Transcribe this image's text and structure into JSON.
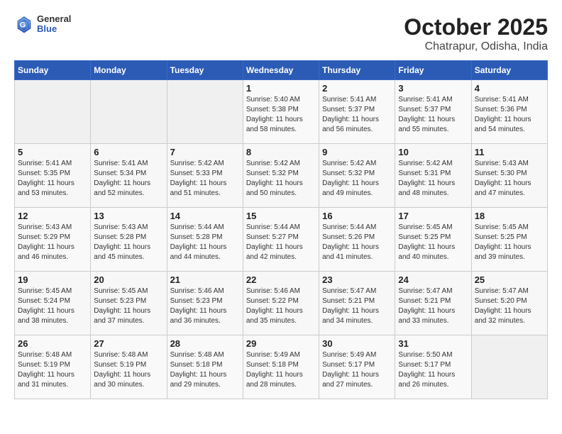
{
  "header": {
    "logo": {
      "general": "General",
      "blue": "Blue"
    },
    "title": "October 2025",
    "location": "Chatrapur, Odisha, India"
  },
  "calendar": {
    "weekdays": [
      "Sunday",
      "Monday",
      "Tuesday",
      "Wednesday",
      "Thursday",
      "Friday",
      "Saturday"
    ],
    "weeks": [
      [
        {
          "day": "",
          "info": ""
        },
        {
          "day": "",
          "info": ""
        },
        {
          "day": "",
          "info": ""
        },
        {
          "day": "1",
          "info": "Sunrise: 5:40 AM\nSunset: 5:38 PM\nDaylight: 11 hours\nand 58 minutes."
        },
        {
          "day": "2",
          "info": "Sunrise: 5:41 AM\nSunset: 5:37 PM\nDaylight: 11 hours\nand 56 minutes."
        },
        {
          "day": "3",
          "info": "Sunrise: 5:41 AM\nSunset: 5:37 PM\nDaylight: 11 hours\nand 55 minutes."
        },
        {
          "day": "4",
          "info": "Sunrise: 5:41 AM\nSunset: 5:36 PM\nDaylight: 11 hours\nand 54 minutes."
        }
      ],
      [
        {
          "day": "5",
          "info": "Sunrise: 5:41 AM\nSunset: 5:35 PM\nDaylight: 11 hours\nand 53 minutes."
        },
        {
          "day": "6",
          "info": "Sunrise: 5:41 AM\nSunset: 5:34 PM\nDaylight: 11 hours\nand 52 minutes."
        },
        {
          "day": "7",
          "info": "Sunrise: 5:42 AM\nSunset: 5:33 PM\nDaylight: 11 hours\nand 51 minutes."
        },
        {
          "day": "8",
          "info": "Sunrise: 5:42 AM\nSunset: 5:32 PM\nDaylight: 11 hours\nand 50 minutes."
        },
        {
          "day": "9",
          "info": "Sunrise: 5:42 AM\nSunset: 5:32 PM\nDaylight: 11 hours\nand 49 minutes."
        },
        {
          "day": "10",
          "info": "Sunrise: 5:42 AM\nSunset: 5:31 PM\nDaylight: 11 hours\nand 48 minutes."
        },
        {
          "day": "11",
          "info": "Sunrise: 5:43 AM\nSunset: 5:30 PM\nDaylight: 11 hours\nand 47 minutes."
        }
      ],
      [
        {
          "day": "12",
          "info": "Sunrise: 5:43 AM\nSunset: 5:29 PM\nDaylight: 11 hours\nand 46 minutes."
        },
        {
          "day": "13",
          "info": "Sunrise: 5:43 AM\nSunset: 5:28 PM\nDaylight: 11 hours\nand 45 minutes."
        },
        {
          "day": "14",
          "info": "Sunrise: 5:44 AM\nSunset: 5:28 PM\nDaylight: 11 hours\nand 44 minutes."
        },
        {
          "day": "15",
          "info": "Sunrise: 5:44 AM\nSunset: 5:27 PM\nDaylight: 11 hours\nand 42 minutes."
        },
        {
          "day": "16",
          "info": "Sunrise: 5:44 AM\nSunset: 5:26 PM\nDaylight: 11 hours\nand 41 minutes."
        },
        {
          "day": "17",
          "info": "Sunrise: 5:45 AM\nSunset: 5:25 PM\nDaylight: 11 hours\nand 40 minutes."
        },
        {
          "day": "18",
          "info": "Sunrise: 5:45 AM\nSunset: 5:25 PM\nDaylight: 11 hours\nand 39 minutes."
        }
      ],
      [
        {
          "day": "19",
          "info": "Sunrise: 5:45 AM\nSunset: 5:24 PM\nDaylight: 11 hours\nand 38 minutes."
        },
        {
          "day": "20",
          "info": "Sunrise: 5:45 AM\nSunset: 5:23 PM\nDaylight: 11 hours\nand 37 minutes."
        },
        {
          "day": "21",
          "info": "Sunrise: 5:46 AM\nSunset: 5:23 PM\nDaylight: 11 hours\nand 36 minutes."
        },
        {
          "day": "22",
          "info": "Sunrise: 5:46 AM\nSunset: 5:22 PM\nDaylight: 11 hours\nand 35 minutes."
        },
        {
          "day": "23",
          "info": "Sunrise: 5:47 AM\nSunset: 5:21 PM\nDaylight: 11 hours\nand 34 minutes."
        },
        {
          "day": "24",
          "info": "Sunrise: 5:47 AM\nSunset: 5:21 PM\nDaylight: 11 hours\nand 33 minutes."
        },
        {
          "day": "25",
          "info": "Sunrise: 5:47 AM\nSunset: 5:20 PM\nDaylight: 11 hours\nand 32 minutes."
        }
      ],
      [
        {
          "day": "26",
          "info": "Sunrise: 5:48 AM\nSunset: 5:19 PM\nDaylight: 11 hours\nand 31 minutes."
        },
        {
          "day": "27",
          "info": "Sunrise: 5:48 AM\nSunset: 5:19 PM\nDaylight: 11 hours\nand 30 minutes."
        },
        {
          "day": "28",
          "info": "Sunrise: 5:48 AM\nSunset: 5:18 PM\nDaylight: 11 hours\nand 29 minutes."
        },
        {
          "day": "29",
          "info": "Sunrise: 5:49 AM\nSunset: 5:18 PM\nDaylight: 11 hours\nand 28 minutes."
        },
        {
          "day": "30",
          "info": "Sunrise: 5:49 AM\nSunset: 5:17 PM\nDaylight: 11 hours\nand 27 minutes."
        },
        {
          "day": "31",
          "info": "Sunrise: 5:50 AM\nSunset: 5:17 PM\nDaylight: 11 hours\nand 26 minutes."
        },
        {
          "day": "",
          "info": ""
        }
      ]
    ]
  }
}
